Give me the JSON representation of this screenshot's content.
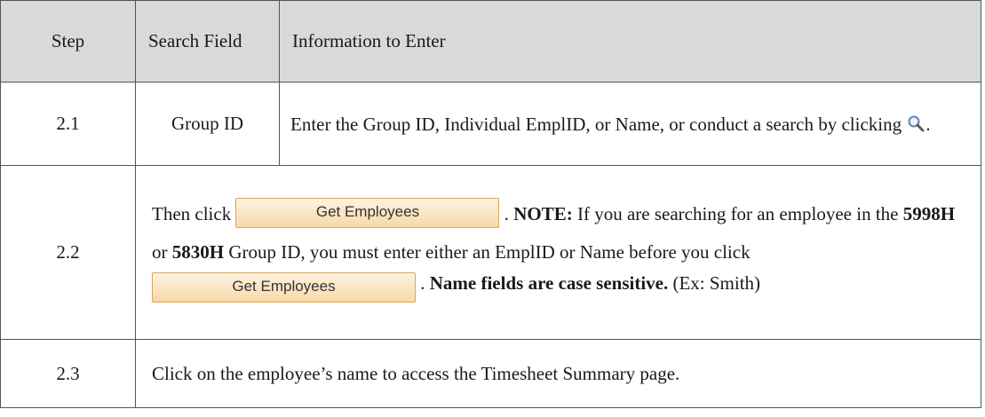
{
  "header": {
    "step": "Step",
    "search_field": "Search Field",
    "info": "Information to Enter"
  },
  "rows": [
    {
      "step": "2.1",
      "field": "Group ID",
      "text_a": "Enter the Group ID, Individual EmplID, or Name, or conduct a search by clicking",
      "text_b": ".",
      "icon": "magnifier-icon"
    },
    {
      "step": "2.2",
      "then_click": "Then click",
      "button_label": "Get Employees",
      "dot_sep": ".",
      "note_label": "NOTE:",
      "note_text_a": "If you are searching for an employee in the",
      "group_a": "5998H",
      "or": "or",
      "group_b": "5830H",
      "note_text_b": "Group ID, you must enter either an EmplID or Name before you click",
      "dot_sep2": ".",
      "bold_tail": "Name fields are case sensitive.",
      "example": "(Ex: Smith)"
    },
    {
      "step": "2.3",
      "text": "Click on the employee’s name to access the Timesheet Summary page."
    }
  ],
  "colors": {
    "header_bg": "#d9d9d9",
    "border": "#555555",
    "button_bg": "#f7d9a8",
    "button_border": "#d9a55a"
  }
}
